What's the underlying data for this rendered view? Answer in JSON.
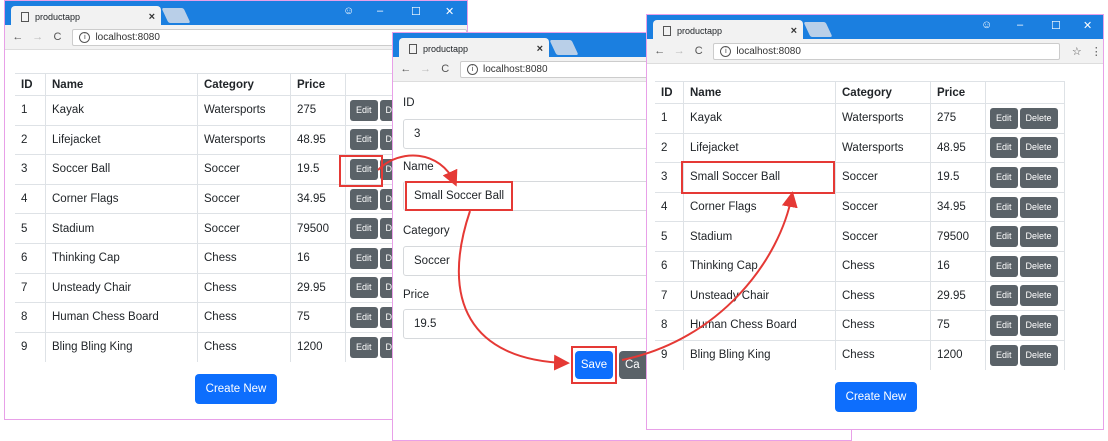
{
  "browser": {
    "tab_title": "productapp",
    "tab_close": "×",
    "url": "localhost:8080",
    "back": "←",
    "forward": "→",
    "reload": "C",
    "info": "i",
    "star": "☆",
    "menu": "⋮",
    "min": "–",
    "max": "☐",
    "close": "✕",
    "user": "☺"
  },
  "table": {
    "headers": [
      "ID",
      "Name",
      "Category",
      "Price"
    ],
    "edit_label": "Edit",
    "delete_label": "Delete",
    "delete_partial": "D",
    "rows_before": [
      [
        "1",
        "Kayak",
        "Watersports",
        "275"
      ],
      [
        "2",
        "Lifejacket",
        "Watersports",
        "48.95"
      ],
      [
        "3",
        "Soccer Ball",
        "Soccer",
        "19.5"
      ],
      [
        "4",
        "Corner Flags",
        "Soccer",
        "34.95"
      ],
      [
        "5",
        "Stadium",
        "Soccer",
        "79500"
      ],
      [
        "6",
        "Thinking Cap",
        "Chess",
        "16"
      ],
      [
        "7",
        "Unsteady Chair",
        "Chess",
        "29.95"
      ],
      [
        "8",
        "Human Chess Board",
        "Chess",
        "75"
      ],
      [
        "9",
        "Bling Bling King",
        "Chess",
        "1200"
      ]
    ],
    "rows_after": [
      [
        "1",
        "Kayak",
        "Watersports",
        "275"
      ],
      [
        "2",
        "Lifejacket",
        "Watersports",
        "48.95"
      ],
      [
        "3",
        "Small Soccer Ball",
        "Soccer",
        "19.5"
      ],
      [
        "4",
        "Corner Flags",
        "Soccer",
        "34.95"
      ],
      [
        "5",
        "Stadium",
        "Soccer",
        "79500"
      ],
      [
        "6",
        "Thinking Cap",
        "Chess",
        "16"
      ],
      [
        "7",
        "Unsteady Chair",
        "Chess",
        "29.95"
      ],
      [
        "8",
        "Human Chess Board",
        "Chess",
        "75"
      ],
      [
        "9",
        "Bling Bling King",
        "Chess",
        "1200"
      ]
    ],
    "create_label": "Create New"
  },
  "form": {
    "id_label": "ID",
    "id_value": "3",
    "name_label": "Name",
    "name_value": "Small Soccer Ball",
    "category_label": "Category",
    "category_value": "Soccer",
    "price_label": "Price",
    "price_value": "19.5",
    "save_label": "Save",
    "cancel_partial": "Ca"
  },
  "colors": {
    "titlebar": "#1b7fe0",
    "highlight": "#e53935",
    "primary": "#0d6efd",
    "secondary": "#5a6268"
  }
}
